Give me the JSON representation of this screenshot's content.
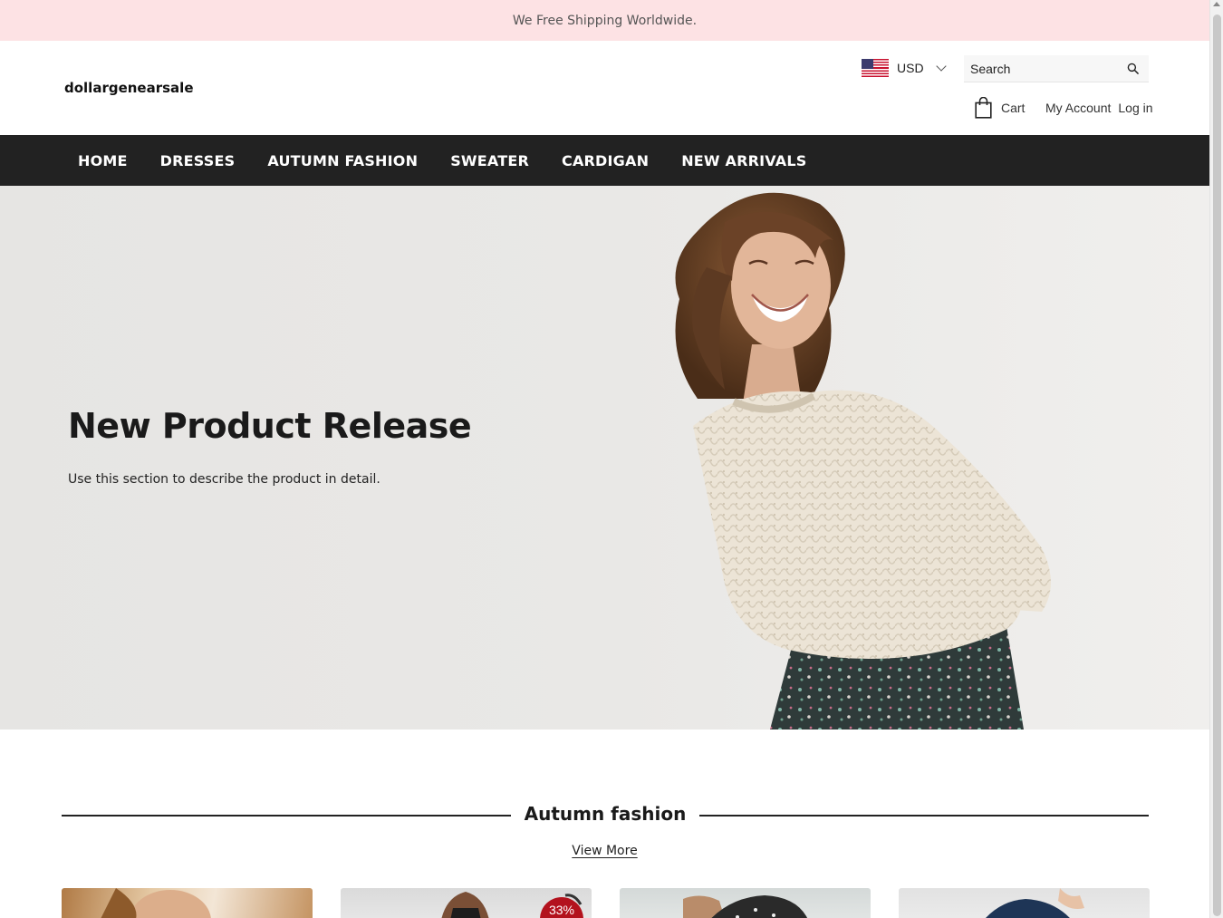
{
  "announcement": "We Free Shipping Worldwide.",
  "header": {
    "logo": "dollargenearsale",
    "currency": "USD",
    "search_placeholder": "Search",
    "cart_label": "Cart",
    "account_label": "My Account",
    "login_label": "Log in"
  },
  "nav": {
    "items": [
      "HOME",
      "DRESSES",
      "AUTUMN FASHION",
      "SWEATER",
      "CARDIGAN",
      "NEW ARRIVALS"
    ]
  },
  "hero": {
    "title": "New Product Release",
    "text": "Use this section to describe the product in detail."
  },
  "section": {
    "title": "Autumn fashion",
    "view_more": "View More",
    "badge": "33%"
  },
  "colors": {
    "announcement_bg": "#fde2e4",
    "nav_bg": "#222222",
    "badge_bg": "#b3121d"
  }
}
